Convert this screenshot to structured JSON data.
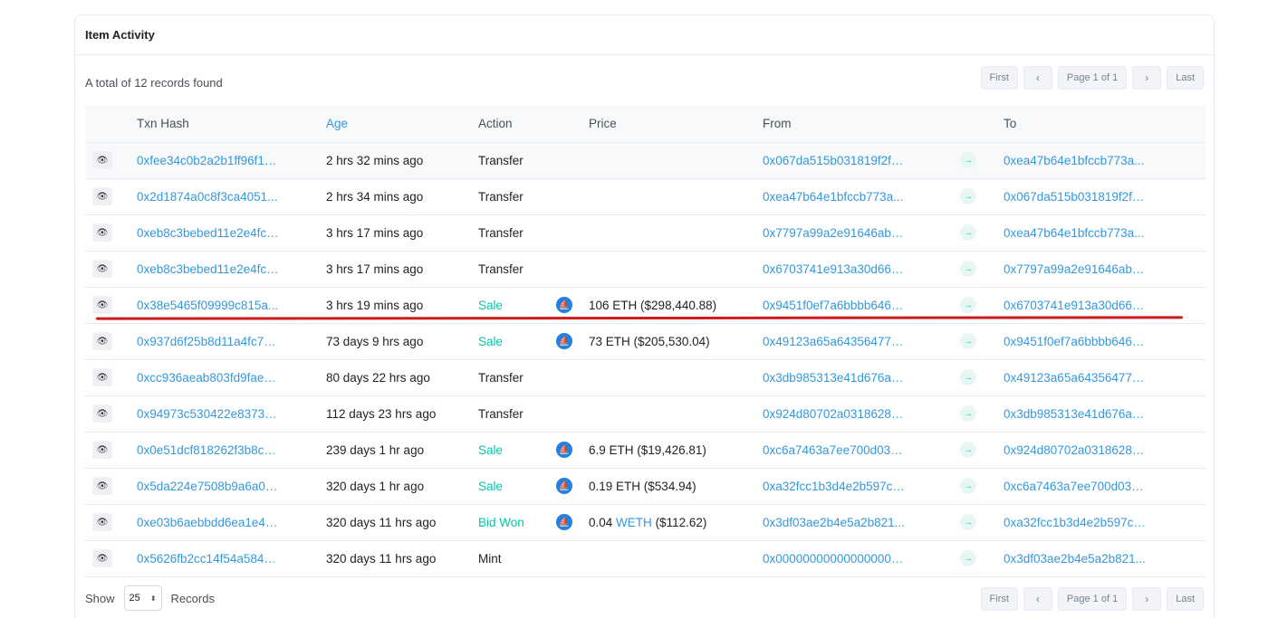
{
  "card": {
    "title": "Item Activity"
  },
  "summary": "A total of 12 records found",
  "pagination": {
    "first": "First",
    "prev": "‹",
    "page": "Page 1 of 1",
    "next": "›",
    "last": "Last"
  },
  "columns": {
    "txn_hash": "Txn Hash",
    "age": "Age",
    "action": "Action",
    "price": "Price",
    "from": "From",
    "to": "To"
  },
  "rows": [
    {
      "hash": "0xfee34c0b2a2b1ff96f12...",
      "age": "2 hrs 32 mins ago",
      "action": "Transfer",
      "action_type": "plain",
      "market": false,
      "price": "",
      "price_currency": "",
      "price_usd": "",
      "from": "0x067da515b031819f2f7...",
      "to": "0xea47b64e1bfccb773a..."
    },
    {
      "hash": "0x2d1874a0c8f3ca4051...",
      "age": "2 hrs 34 mins ago",
      "action": "Transfer",
      "action_type": "plain",
      "market": false,
      "price": "",
      "price_currency": "",
      "price_usd": "",
      "from": "0xea47b64e1bfccb773a...",
      "to": "0x067da515b031819f2f7..."
    },
    {
      "hash": "0xeb8c3bebed11e2e4fcd...",
      "age": "3 hrs 17 mins ago",
      "action": "Transfer",
      "action_type": "plain",
      "market": false,
      "price": "",
      "price_currency": "",
      "price_usd": "",
      "from": "0x7797a99a2e91646abd...",
      "to": "0xea47b64e1bfccb773a..."
    },
    {
      "hash": "0xeb8c3bebed11e2e4fcd...",
      "age": "3 hrs 17 mins ago",
      "action": "Transfer",
      "action_type": "plain",
      "market": false,
      "price": "",
      "price_currency": "",
      "price_usd": "",
      "from": "0x6703741e913a30d660...",
      "to": "0x7797a99a2e91646abd..."
    },
    {
      "hash": "0x38e5465f09999c815a...",
      "age": "3 hrs 19 mins ago",
      "action": "Sale",
      "action_type": "green",
      "market": true,
      "price": "106 ETH",
      "price_currency": "",
      "price_usd": "($298,440.88)",
      "from": "0x9451f0ef7a6bbbb6466...",
      "to": "0x6703741e913a30d660..."
    },
    {
      "hash": "0x937d6f25b8d11a4fc78...",
      "age": "73 days 9 hrs ago",
      "action": "Sale",
      "action_type": "green",
      "market": true,
      "price": "73 ETH",
      "price_currency": "",
      "price_usd": "($205,530.04)",
      "from": "0x49123a65a643564778...",
      "to": "0x9451f0ef7a6bbbb6466..."
    },
    {
      "hash": "0xcc936aeab803fd9faeb...",
      "age": "80 days 22 hrs ago",
      "action": "Transfer",
      "action_type": "plain",
      "market": false,
      "price": "",
      "price_currency": "",
      "price_usd": "",
      "from": "0x3db985313e41d676a6...",
      "to": "0x49123a65a643564778..."
    },
    {
      "hash": "0x94973c530422e83732...",
      "age": "112 days 23 hrs ago",
      "action": "Transfer",
      "action_type": "plain",
      "market": false,
      "price": "",
      "price_currency": "",
      "price_usd": "",
      "from": "0x924d80702a0318628e...",
      "to": "0x3db985313e41d676a6..."
    },
    {
      "hash": "0x0e51dcf818262f3b8c7...",
      "age": "239 days 1 hr ago",
      "action": "Sale",
      "action_type": "green",
      "market": true,
      "price": "6.9 ETH",
      "price_currency": "",
      "price_usd": "($19,426.81)",
      "from": "0xc6a7463a7ee700d035...",
      "to": "0x924d80702a0318628e..."
    },
    {
      "hash": "0x5da224e7508b9a6a04...",
      "age": "320 days 1 hr ago",
      "action": "Sale",
      "action_type": "green",
      "market": true,
      "price": "0.19 ETH",
      "price_currency": "",
      "price_usd": "($534.94)",
      "from": "0xa32fcc1b3d4e2b597cf...",
      "to": "0xc6a7463a7ee700d035..."
    },
    {
      "hash": "0xe03b6aebbdd6ea1e44...",
      "age": "320 days 11 hrs ago",
      "action": "Bid Won",
      "action_type": "green",
      "market": true,
      "price": "0.04",
      "price_currency": "WETH",
      "price_usd": "($112.62)",
      "from": "0x3df03ae2b4e5a2b821...",
      "to": "0xa32fcc1b3d4e2b597cf..."
    },
    {
      "hash": "0x5626fb2cc14f54a584d...",
      "age": "320 days 11 hrs ago",
      "action": "Mint",
      "action_type": "plain",
      "market": false,
      "price": "",
      "price_currency": "",
      "price_usd": "",
      "from": "0x000000000000000000...",
      "to": "0x3df03ae2b4e5a2b821..."
    }
  ],
  "footer": {
    "show": "Show",
    "page_size": "25",
    "records": "Records"
  },
  "icons": {
    "view": "eye-icon",
    "market": "opensea-icon",
    "direction": "arrow-right-icon"
  },
  "colors": {
    "link": "#3498db",
    "success": "#00c9a7",
    "annotation": "#cc1b1b"
  }
}
